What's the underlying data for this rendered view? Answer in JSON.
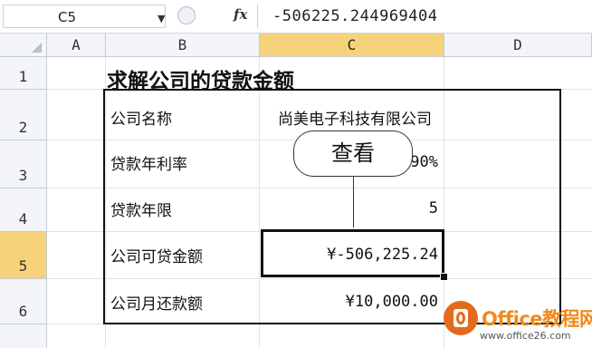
{
  "formula_bar": {
    "name_box": "C5",
    "fx": "fx",
    "formula": "-506225.244969404"
  },
  "columns": [
    "A",
    "B",
    "C",
    "D"
  ],
  "rows": [
    "1",
    "2",
    "3",
    "4",
    "5",
    "6"
  ],
  "selected": {
    "column": "C",
    "row": "5"
  },
  "sheet": {
    "title": "求解公司的贷款金额",
    "rows": [
      {
        "label": "公司名称",
        "value": "尚美电子科技有限公司"
      },
      {
        "label": "贷款年利率",
        "value": "90%"
      },
      {
        "label": "贷款年限",
        "value": "5"
      },
      {
        "label": "公司可贷金额",
        "value": "¥-506,225.24"
      },
      {
        "label": "公司月还款额",
        "value": "¥10,000.00"
      }
    ]
  },
  "callout": {
    "text": "查看"
  },
  "watermark": {
    "brand": "Office教程网",
    "url": "www.office26.com"
  },
  "colors": {
    "selected_header": "#f6d27a",
    "grid_line": "#dfe3e8",
    "watermark_orange": "#e46a1c"
  }
}
